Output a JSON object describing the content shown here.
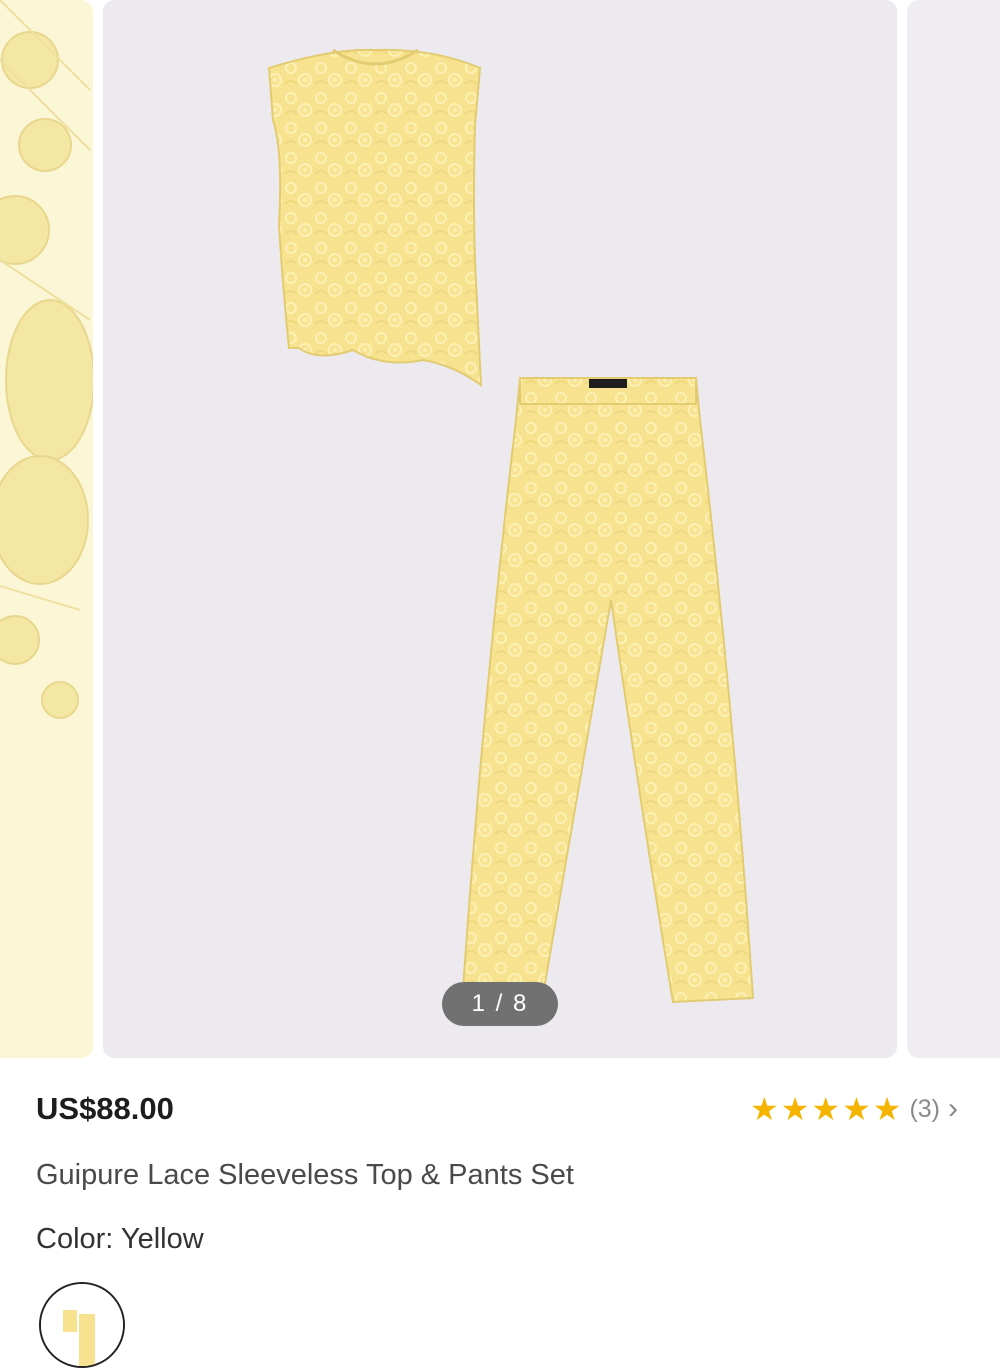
{
  "gallery": {
    "counter": "1 / 8",
    "current_image": 1,
    "total_images": 8
  },
  "product": {
    "price": "US$88.00",
    "title": "Guipure Lace Sleeveless Top & Pants Set",
    "rating": 5,
    "review_count": "(3)",
    "color_label": "Color:",
    "color_value": "Yellow"
  },
  "icons": {
    "rating_star": "star-icon",
    "reviews_link": "chevron-right-icon"
  },
  "colors": {
    "accent_star": "#f5b400",
    "product_yellow": "#f7e38f",
    "image_background": "#eceaee"
  }
}
